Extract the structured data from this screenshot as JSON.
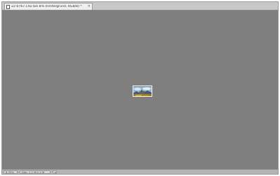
{
  "document": {
    "tab_title": "22-0767.C92 bei 8% (Hintergrund, RGB/8) *",
    "close_symbol": "×"
  },
  "status_bar": {
    "zoom": "8,33%",
    "doc_info": "Dok: 1,2 M/1,2 M",
    "arrow": "▸"
  },
  "canvas": {
    "background_color": "#7f7f7f",
    "image_content": "landscape photo thumbnail"
  }
}
